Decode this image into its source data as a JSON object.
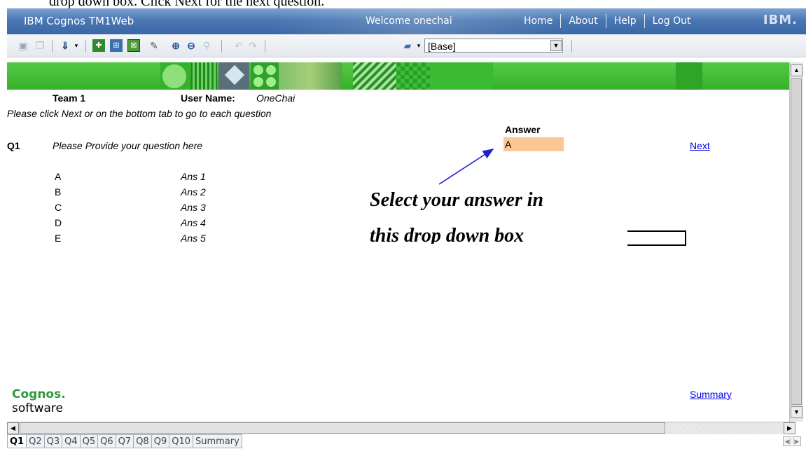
{
  "doc_text": "drop down box.  Click Next for the next question.",
  "header": {
    "app_title": "IBM Cognos TM1Web",
    "welcome": "Welcome onechai",
    "nav": {
      "home": "Home",
      "about": "About",
      "help": "Help",
      "logout": "Log Out"
    },
    "logo": "IBM."
  },
  "toolbar": {
    "cube_view": "[Base]"
  },
  "content": {
    "team": "Team 1",
    "user_name_label": "User Name:",
    "user_name_value": "OneChai",
    "instruction": "Please click Next or on the bottom tab to go to each question",
    "answer_header": "Answer",
    "question_number": "Q1",
    "question_text": "Please Provide your question here",
    "answer_value": "A",
    "next_link": "Next",
    "options": [
      {
        "letter": "A",
        "text": "Ans 1"
      },
      {
        "letter": "B",
        "text": "Ans 2"
      },
      {
        "letter": "C",
        "text": "Ans 3"
      },
      {
        "letter": "D",
        "text": "Ans 4"
      },
      {
        "letter": "E",
        "text": "Ans 5"
      }
    ],
    "callout_line1": "Select your answer in",
    "callout_line2": "this drop down box",
    "summary_link": "Summary"
  },
  "footer_logo": {
    "line1": "Cognos.",
    "line2": "software"
  },
  "tabs": [
    "Q1",
    "Q2",
    "Q3",
    "Q4",
    "Q5",
    "Q6",
    "Q7",
    "Q8",
    "Q9",
    "Q10",
    "Summary"
  ],
  "colors": {
    "header_blue": "#3a67a6",
    "banner_green": "#36b12c",
    "answer_cell": "#fcc695",
    "link_blue": "#0000ee",
    "cognos_green": "#2e9a3c"
  }
}
